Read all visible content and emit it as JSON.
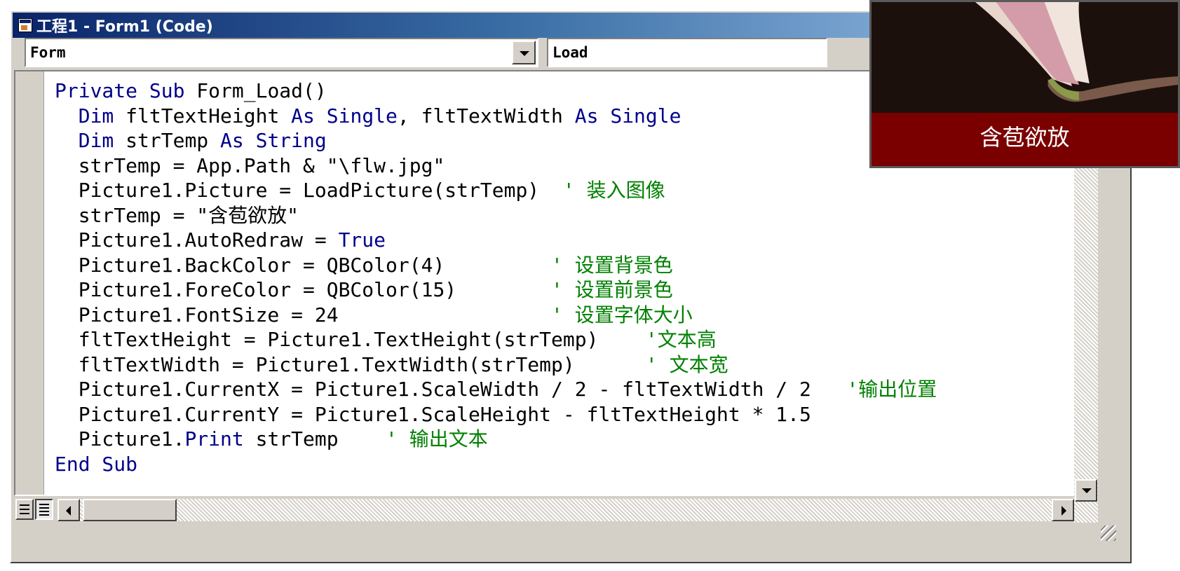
{
  "window": {
    "title": "工程1 - Form1 (Code)"
  },
  "object_combo": {
    "value": "Form"
  },
  "procedure_combo": {
    "value": "Load"
  },
  "code_lines": [
    [
      {
        "t": "Private Sub",
        "c": "kw"
      },
      {
        "t": " Form_Load()",
        "c": ""
      }
    ],
    [
      {
        "t": "  ",
        "c": ""
      },
      {
        "t": "Dim",
        "c": "kw"
      },
      {
        "t": " fltTextHeight ",
        "c": ""
      },
      {
        "t": "As Single",
        "c": "kw"
      },
      {
        "t": ", fltTextWidth ",
        "c": ""
      },
      {
        "t": "As Single",
        "c": "kw"
      }
    ],
    [
      {
        "t": "  ",
        "c": ""
      },
      {
        "t": "Dim",
        "c": "kw"
      },
      {
        "t": " strTemp ",
        "c": ""
      },
      {
        "t": "As String",
        "c": "kw"
      }
    ],
    [
      {
        "t": "  strTemp = App.Path & \"\\flw.jpg\"",
        "c": ""
      }
    ],
    [
      {
        "t": "  Picture1.Picture = LoadPicture(strTemp)  ",
        "c": ""
      },
      {
        "t": "' 装入图像",
        "c": "cm"
      }
    ],
    [
      {
        "t": "  strTemp = \"含苞欲放\"",
        "c": ""
      }
    ],
    [
      {
        "t": "  Picture1.AutoRedraw = ",
        "c": ""
      },
      {
        "t": "True",
        "c": "kw"
      }
    ],
    [
      {
        "t": "  Picture1.BackColor = QBColor(4)         ",
        "c": ""
      },
      {
        "t": "' 设置背景色",
        "c": "cm"
      }
    ],
    [
      {
        "t": "  Picture1.ForeColor = QBColor(15)        ",
        "c": ""
      },
      {
        "t": "' 设置前景色",
        "c": "cm"
      }
    ],
    [
      {
        "t": "  Picture1.FontSize = 24                  ",
        "c": ""
      },
      {
        "t": "' 设置字体大小",
        "c": "cm"
      }
    ],
    [
      {
        "t": "  fltTextHeight = Picture1.TextHeight(strTemp)    ",
        "c": ""
      },
      {
        "t": "'文本高",
        "c": "cm"
      }
    ],
    [
      {
        "t": "  fltTextWidth = Picture1.TextWidth(strTemp)      ",
        "c": ""
      },
      {
        "t": "' 文本宽",
        "c": "cm"
      }
    ],
    [
      {
        "t": "  Picture1.CurrentX = Picture1.ScaleWidth / 2 - fltTextWidth / 2   ",
        "c": ""
      },
      {
        "t": "'输出位置",
        "c": "cm"
      }
    ],
    [
      {
        "t": "  Picture1.CurrentY = Picture1.ScaleHeight - fltTextHeight * 1.5",
        "c": ""
      }
    ],
    [
      {
        "t": "  Picture1.",
        "c": ""
      },
      {
        "t": "Print",
        "c": "kw"
      },
      {
        "t": " strTemp    ",
        "c": ""
      },
      {
        "t": "' 输出文本",
        "c": "cm"
      }
    ],
    [
      {
        "t": "End Sub",
        "c": "kw"
      }
    ]
  ],
  "picture_preview": {
    "caption": "含苞欲放"
  },
  "colors": {
    "keyword": "#00008b",
    "comment": "#008000",
    "caption_bg": "#7a0000"
  },
  "icons": [
    "form-icon",
    "dropdown-arrow-icon",
    "procedure-view-icon",
    "full-module-view-icon",
    "scroll-left-icon",
    "scroll-right-icon",
    "scroll-down-icon",
    "resize-grip-icon"
  ]
}
